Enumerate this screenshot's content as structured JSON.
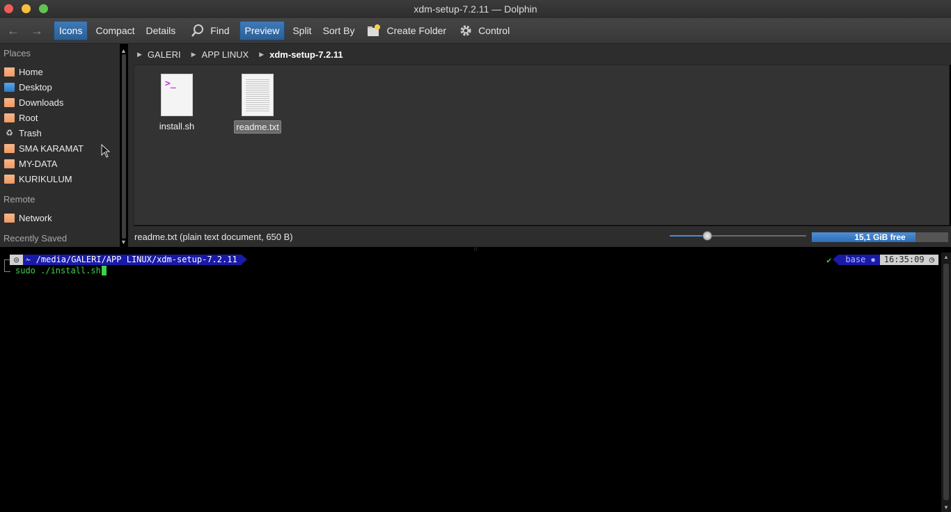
{
  "window": {
    "title": "xdm-setup-7.2.11 — Dolphin"
  },
  "toolbar": {
    "back_icon": "arrow-left-icon",
    "forward_icon": "arrow-right-icon",
    "icons": "Icons",
    "compact": "Compact",
    "details": "Details",
    "find": "Find",
    "preview": "Preview",
    "split": "Split",
    "sort_by": "Sort By",
    "create_folder": "Create Folder",
    "control": "Control"
  },
  "sidebar": {
    "places_label": "Places",
    "places": [
      {
        "label": "Home",
        "icon": "home-folder-icon"
      },
      {
        "label": "Desktop",
        "icon": "desktop-icon"
      },
      {
        "label": "Downloads",
        "icon": "folder-icon"
      },
      {
        "label": "Root",
        "icon": "folder-icon"
      },
      {
        "label": "Trash",
        "icon": "trash-icon"
      },
      {
        "label": "SMA KARAMAT",
        "icon": "folder-icon"
      },
      {
        "label": "MY-DATA",
        "icon": "folder-icon"
      },
      {
        "label": "KURIKULUM",
        "icon": "folder-icon"
      }
    ],
    "remote_label": "Remote",
    "remote": [
      {
        "label": "Network",
        "icon": "folder-icon"
      }
    ],
    "recent_label": "Recently Saved"
  },
  "breadcrumb": {
    "items": [
      "GALERI",
      "APP LINUX",
      "xdm-setup-7.2.11"
    ]
  },
  "files": [
    {
      "name": "install.sh",
      "type": "shell-script",
      "selected": false
    },
    {
      "name": "readme.txt",
      "type": "text",
      "selected": true
    }
  ],
  "statusbar": {
    "text": "readme.txt (plain text document, 650 B)",
    "zoom_level": 0.27,
    "free_space": "15,1 GiB free",
    "used_fraction": 0.76
  },
  "terminal": {
    "os_icon": "os-logo-icon",
    "path": "✁ /media/GALERI/APP LINUX/xdm-setup-7.2.11",
    "command": "sudo ./install.sh",
    "status_check": "✔",
    "env": "base ✹",
    "time": "16:35:09 ◷"
  },
  "colors": {
    "accent": "#2c5f95",
    "terminal_green": "#3fd24a",
    "prompt_blue": "#1a1aa8",
    "folder": "#ee9a63"
  }
}
